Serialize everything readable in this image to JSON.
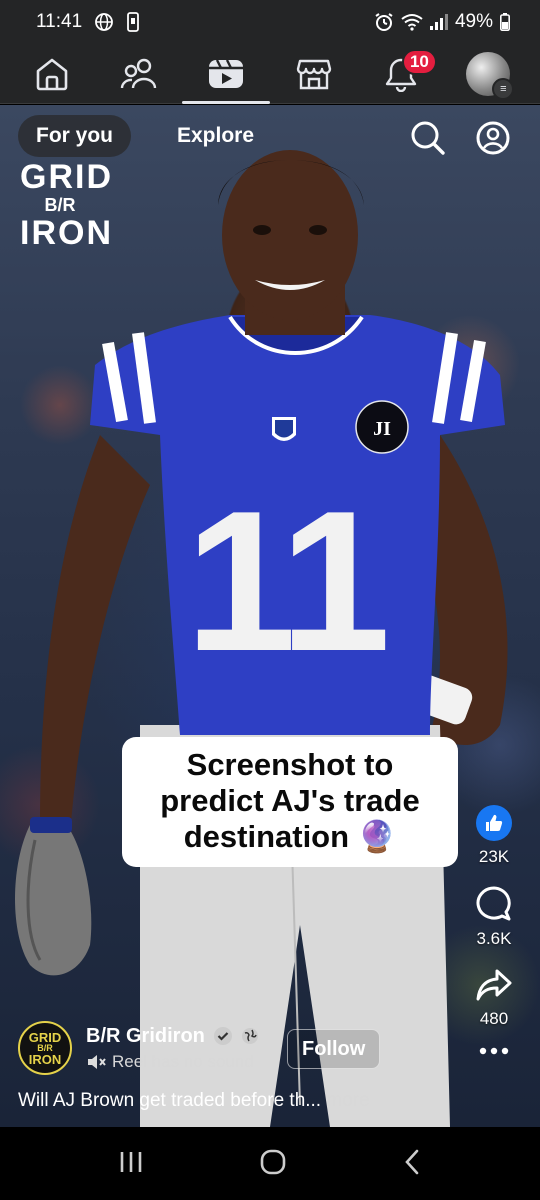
{
  "status_bar": {
    "time": "11:41",
    "battery": "49%"
  },
  "top_nav": {
    "items": [
      {
        "name": "home-icon"
      },
      {
        "name": "friends-icon"
      },
      {
        "name": "reels-icon",
        "active": true
      },
      {
        "name": "marketplace-icon"
      },
      {
        "name": "notifications-icon",
        "badge": "10"
      },
      {
        "name": "profile-avatar"
      }
    ],
    "badge_color": "#e41e3f"
  },
  "reels": {
    "tabs": [
      {
        "label": "For you",
        "active": true
      },
      {
        "label": "Explore",
        "active": false
      }
    ],
    "overlay_logo": {
      "line1": "GRID",
      "line2": "B/R",
      "line3": "IRON"
    },
    "caption": {
      "line1": "Screenshot to",
      "line2": "predict AJ's trade",
      "line3": "destination 🔮"
    },
    "actions": {
      "likes": "23K",
      "comments": "3.6K",
      "shares": "480"
    },
    "author": {
      "avatar_lines": {
        "line1": "GRID",
        "line2": "B/R",
        "line3": "IRON"
      },
      "name": "B/R Gridiron",
      "sound_text": "Reel has no sound"
    },
    "follow_label": "Follow",
    "description": "Will AJ Brown get traded before th...",
    "more_label": "more",
    "jersey_number": "11",
    "accent_color": "#1877f2"
  }
}
